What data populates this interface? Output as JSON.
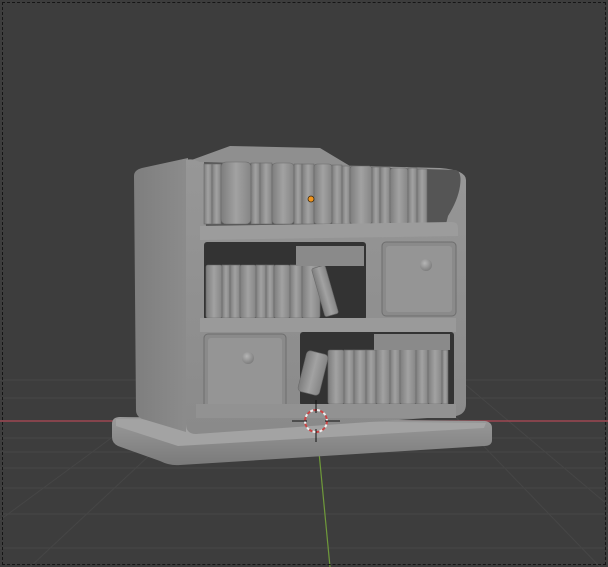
{
  "viewport": {
    "mode": "3d-viewport",
    "shading": "solid",
    "background_color": "#3d3d3d",
    "grid_color": "#464646",
    "x_axis_color": "#b14a55",
    "y_axis_color": "#6f9a3a",
    "object_color": "#8e8e8e",
    "origin_dot_color": "#f0941e",
    "cursor_icon": "3d-cursor-icon",
    "camera_frame": "dashed-border"
  },
  "scene": {
    "object": "bookshelf",
    "top_shelf_books": 16,
    "middle_shelf_books": 9,
    "bottom_shelf_books": 9,
    "drawers": 2
  }
}
